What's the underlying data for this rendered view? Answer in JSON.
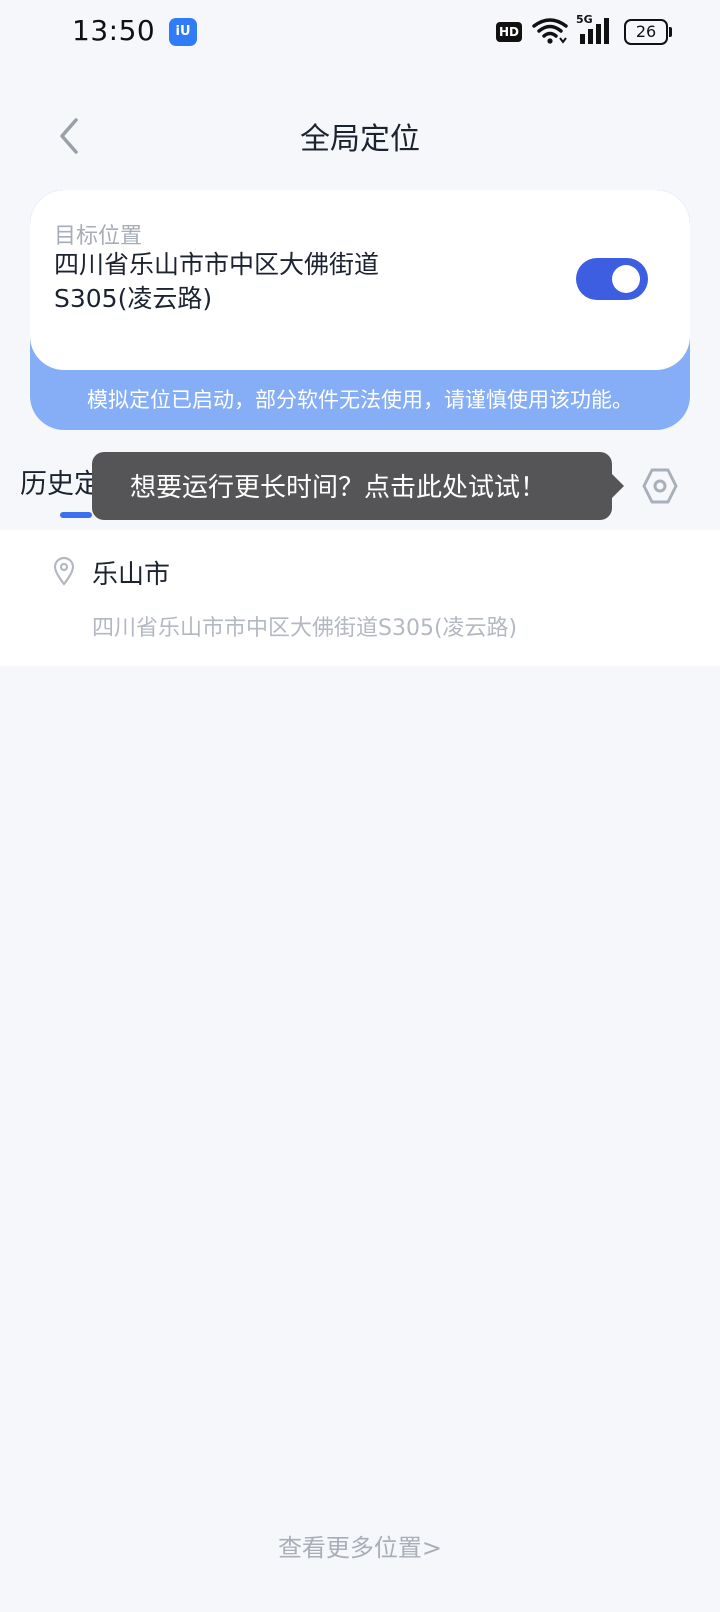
{
  "status_bar": {
    "time": "13:50",
    "app_badge": "iU",
    "hd_label": "HD",
    "network_label": "5G",
    "battery_level": "26"
  },
  "header": {
    "title": "全局定位"
  },
  "target_card": {
    "label": "目标位置",
    "address": "四川省乐山市市中区大佛街道S305(凌云路)",
    "toggle_on": true,
    "warning": "模拟定位已启动，部分软件无法使用，请谨慎使用该功能。"
  },
  "tabs": {
    "history_label": "历史定位"
  },
  "tooltip": {
    "text": "想要运行更长时间？点击此处试试！"
  },
  "history": {
    "items": [
      {
        "name": "乐山市",
        "address": "四川省乐山市市中区大佛街道S305(凌云路)"
      }
    ]
  },
  "footer": {
    "more_link": "查看更多位置>"
  },
  "colors": {
    "accent": "#3d5ee0",
    "card_banner": "#86aef7",
    "tooltip_bg": "#555557",
    "page_bg": "#f5f7fb"
  }
}
